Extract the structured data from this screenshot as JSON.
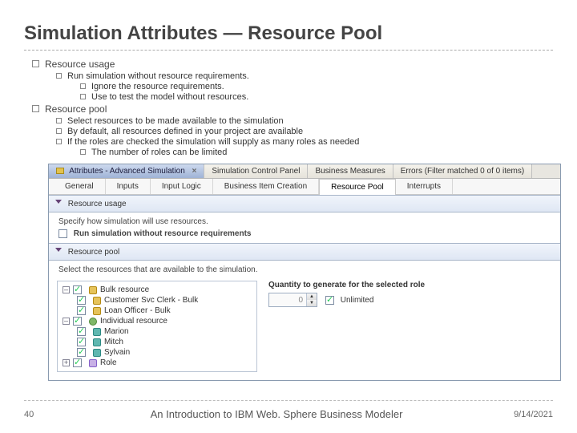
{
  "title": "Simulation Attributes — Resource Pool",
  "bullets": {
    "a": "Resource usage",
    "a1": "Run simulation without resource requirements.",
    "a1a": "Ignore the resource requirements.",
    "a1b": "Use to test the model without resources.",
    "b": "Resource pool",
    "b1": "Select resources to be made available to the simulation",
    "b2": "By default, all resources defined in your project are available",
    "b3": "If the roles are checked the simulation will supply as many roles as needed",
    "b3a": "The number of roles can be limited"
  },
  "tabs_top": {
    "active": "Attributes - Advanced Simulation",
    "t2": "Simulation Control Panel",
    "t3": "Business Measures",
    "t4": "Errors (Filter matched 0 of 0 items)"
  },
  "tabs_sub": {
    "t1": "General",
    "t2": "Inputs",
    "t3": "Input Logic",
    "t4": "Business Item Creation",
    "active": "Resource Pool",
    "t6": "Interrupts"
  },
  "section_usage": {
    "head": "Resource usage",
    "caption": "Specify how simulation will use resources.",
    "chk_label": "Run simulation without resource requirements"
  },
  "section_pool": {
    "head": "Resource pool",
    "caption": "Select the resources that are available to the simulation."
  },
  "tree": {
    "n1": "Bulk resource",
    "n1a": "Customer Svc Clerk - Bulk",
    "n1b": "Loan Officer - Bulk",
    "n2": "Individual resource",
    "n2a": "Marion",
    "n2b": "Mitch",
    "n2c": "Sylvain",
    "n3": "Role"
  },
  "right": {
    "label": "Quantity to generate for the selected role",
    "value": "0",
    "unlimited": "Unlimited"
  },
  "footer": {
    "page": "40",
    "title": "An Introduction to IBM Web. Sphere Business Modeler",
    "date": "9/14/2021"
  }
}
